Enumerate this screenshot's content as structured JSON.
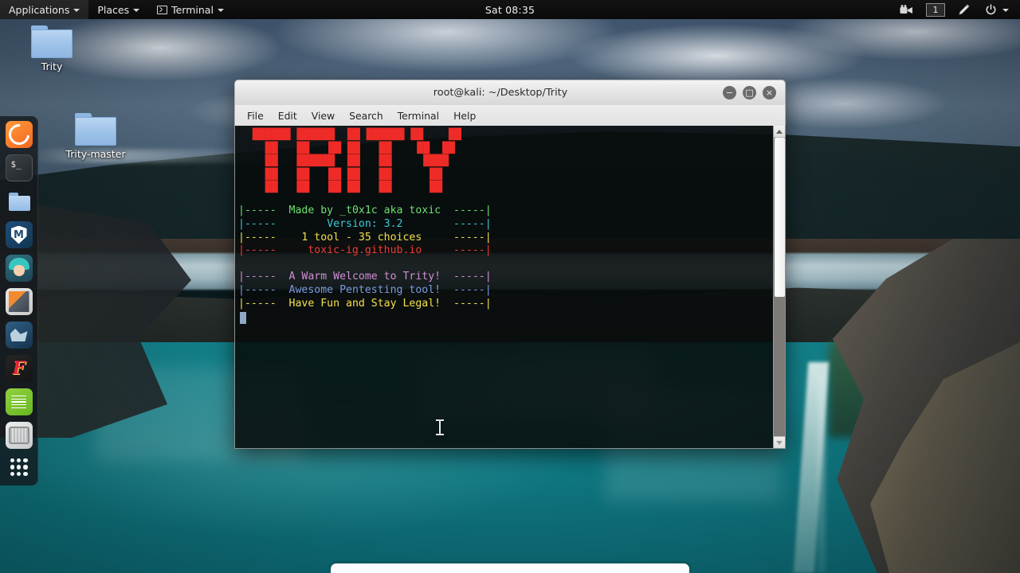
{
  "desktop": {
    "wallpaper_description": "Iceland waterfall canyon with turquoise river",
    "icons": [
      {
        "name": "Trity",
        "type": "folder"
      },
      {
        "name": "Trity-master",
        "type": "folder"
      }
    ]
  },
  "top_panel": {
    "menus": [
      {
        "label": "Applications",
        "icon": "chevron-down-icon"
      },
      {
        "label": "Places",
        "icon": "chevron-down-icon"
      },
      {
        "label": "Terminal",
        "icon": "terminal-icon"
      }
    ],
    "clock": "Sat 08:35",
    "tray": {
      "record_icon": "video-camera-icon",
      "workspace": "1",
      "brightness_icon": "pen-icon",
      "power_icon": "power-icon",
      "power_caret": "chevron-down-icon"
    }
  },
  "dock": {
    "items": [
      {
        "name": "firefox",
        "label": "Firefox ESR",
        "running": true
      },
      {
        "name": "terminal",
        "label": "Terminal",
        "running": true,
        "prompt": "$_"
      },
      {
        "name": "files",
        "label": "Files",
        "running": false
      },
      {
        "name": "metasploit",
        "label": "Metasploit Framework",
        "running": false,
        "glyph": "M"
      },
      {
        "name": "avatar-app",
        "label": "Avatar App",
        "running": false
      },
      {
        "name": "burpsuite",
        "label": "Burp Suite",
        "running": false
      },
      {
        "name": "blue-app",
        "label": "Blue App",
        "running": false
      },
      {
        "name": "faraday",
        "label": "Faraday",
        "running": false,
        "glyph": "F"
      },
      {
        "name": "text-editor",
        "label": "Text Editor",
        "running": true
      },
      {
        "name": "grey-app",
        "label": "Grey App",
        "running": false
      }
    ],
    "show_apps_label": "Show Applications"
  },
  "terminal": {
    "title": "root@kali: ~/Desktop/Trity",
    "window_controls": {
      "minimize": "−",
      "maximize": "□",
      "close": "×"
    },
    "menu": [
      "File",
      "Edit",
      "View",
      "Search",
      "Terminal",
      "Help"
    ],
    "banner_color": "#ee2b26",
    "banner_ascii": [
      "  ██████ ██████  ██ ██████ ██    ██",
      "    ██   ██   ██ ██   ██    ██  ██ ",
      "    ██   ██████  ██   ██     ████  ",
      "    ██   ██   ██ ██   ██      ██   ",
      "    ██   ██   ██ ██   ██      ██   "
    ],
    "info_lines": [
      {
        "left_bar": "|",
        "dashes_left": "-----",
        "text": "Made by _t0x1c aka toxic",
        "dashes_right": "-----",
        "right_bar": "|",
        "color": "#6ee06e",
        "color_name": "green"
      },
      {
        "left_bar": "|",
        "dashes_left": "-----",
        "text": "Version: 3.2",
        "dashes_right": "-----",
        "right_bar": "|",
        "color": "#3fc8d8",
        "color_name": "cyan"
      },
      {
        "left_bar": "|",
        "dashes_left": "-----",
        "text": "1 tool - 35 choices",
        "dashes_right": "-----",
        "right_bar": "|",
        "color": "#f2e04a",
        "color_name": "yellow"
      },
      {
        "left_bar": "|",
        "dashes_left": "-----",
        "text": "toxic-ig.github.io",
        "dashes_right": "-----",
        "right_bar": "|",
        "color": "#ef3b36",
        "color_name": "red"
      }
    ],
    "welcome_lines": [
      {
        "left_bar": "|",
        "dashes_left": "-----",
        "text": "A Warm Welcome to Trity!",
        "dashes_right": "-----",
        "right_bar": "|",
        "color": "#cf8fd4",
        "color_name": "magenta"
      },
      {
        "left_bar": "|",
        "dashes_left": "-----",
        "text": "Awesome Pentesting tool!",
        "dashes_right": "-----",
        "right_bar": "|",
        "color": "#7b9ce0",
        "color_name": "blue"
      },
      {
        "left_bar": "|",
        "dashes_left": "-----",
        "text": "Have Fun and Stay Legal!",
        "dashes_right": "-----",
        "right_bar": "|",
        "color": "#f2e04a",
        "color_name": "yellow"
      }
    ],
    "scrollbar": {
      "up_arrow": "▲",
      "down_arrow": "▼"
    }
  }
}
